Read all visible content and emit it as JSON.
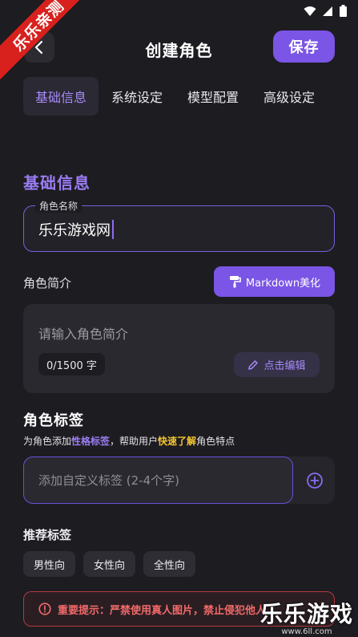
{
  "watermark": {
    "ribbon_text": "乐乐亲测",
    "brand_main": "乐乐游戏",
    "brand_sub": "www.6ll.com"
  },
  "header": {
    "title": "创建角色",
    "save_label": "保存"
  },
  "tabs": [
    {
      "label": "基础信息",
      "active": true
    },
    {
      "label": "系统设定",
      "active": false
    },
    {
      "label": "模型配置",
      "active": false
    },
    {
      "label": "高级设定",
      "active": false
    }
  ],
  "basic": {
    "section_title": "基础信息",
    "name_label": "角色名称",
    "name_value": "乐乐游戏网",
    "intro_label": "角色简介",
    "markdown_button": "Markdown美化",
    "intro_placeholder": "请输入角色简介",
    "char_count": "0/1500 字",
    "edit_button": "点击编辑"
  },
  "tags": {
    "title": "角色标签",
    "hint_prefix": "为角色添加",
    "hint_highlight1": "性格标签",
    "hint_middle": "，帮助用户",
    "hint_highlight2": "快速了解",
    "hint_suffix": "角色特点",
    "input_placeholder": "添加自定义标签 (2-4个字)",
    "recommended_title": "推荐标签",
    "recommended": [
      "男性向",
      "女性向",
      "全性向"
    ]
  },
  "warning": {
    "text": "重要提示：严禁使用真人图片，禁止侵犯他人"
  },
  "colors": {
    "accent": "#7a55e6",
    "accent_text": "#9a7cf4",
    "background": "#1d1c21",
    "warning": "#f26a6a",
    "highlight_yellow": "#f3c530"
  }
}
